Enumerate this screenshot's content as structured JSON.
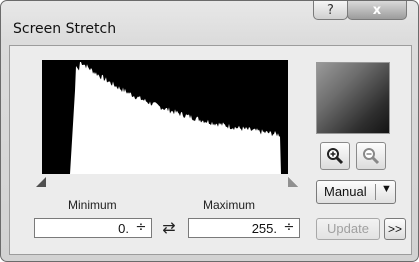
{
  "window": {
    "title": "Screen Stretch",
    "help_label": "?",
    "close_label": "x"
  },
  "labels": {
    "minimum": "Minimum",
    "maximum": "Maximum"
  },
  "fields": {
    "minimum_value": "0.",
    "maximum_value": "255."
  },
  "controls": {
    "mode_value": "Manual",
    "update_label": "Update",
    "more_label": ">>",
    "spin_glyph": "÷",
    "swap_glyph": "⇄",
    "dropdown_glyph": "▼"
  },
  "icons": [
    "zoom-in-icon",
    "zoom-out-icon",
    "swap-arrows-icon",
    "chevron-down-icon"
  ],
  "colors": {
    "histogram_bg": "#000000",
    "histogram_fill": "#ffffff",
    "update_disabled_text": "#a0a0a0"
  }
}
